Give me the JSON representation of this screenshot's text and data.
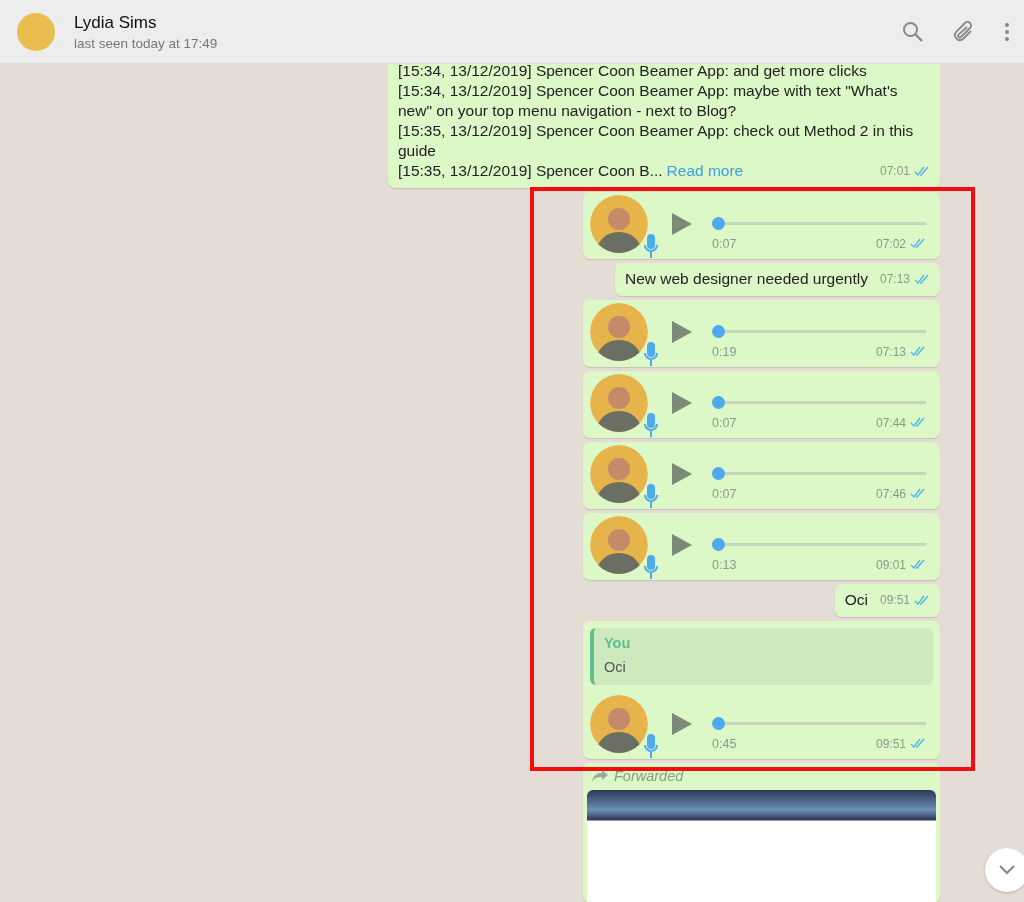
{
  "header": {
    "name": "Lydia Sims",
    "status": "last seen today at 17:49"
  },
  "messages": [
    {
      "kind": "text",
      "lines": [
        "[15:34, 13/12/2019] Spencer Coon Beamer App: and get more clicks",
        "[15:34, 13/12/2019] Spencer Coon Beamer App: maybe with text \"What's new\" on your top menu navigation - next to Blog?",
        "[15:35, 13/12/2019] Spencer Coon Beamer App: check out Method 2 in this guide",
        "[15:35, 13/12/2019] Spencer Coon B..."
      ],
      "read_more": "Read more",
      "time": "07:01"
    },
    {
      "kind": "voice",
      "duration": "0:07",
      "time": "07:02",
      "level": 0
    },
    {
      "kind": "text",
      "lines": [
        "New web designer needed urgently"
      ],
      "time": "07:13"
    },
    {
      "kind": "voice",
      "duration": "0:19",
      "time": "07:13",
      "level": 0
    },
    {
      "kind": "voice",
      "duration": "0:07",
      "time": "07:44",
      "level": 0
    },
    {
      "kind": "voice",
      "duration": "0:07",
      "time": "07:46",
      "level": 0
    },
    {
      "kind": "voice",
      "duration": "0:13",
      "time": "09:01",
      "level": 0
    },
    {
      "kind": "text",
      "lines": [
        "Oci"
      ],
      "time": "09:51"
    },
    {
      "kind": "reply_voice",
      "quote_author": "You",
      "quote_text": "Oci",
      "duration": "0:45",
      "time": "09:51",
      "level": 0
    },
    {
      "kind": "forwarded_image",
      "label": "Forwarded"
    }
  ]
}
